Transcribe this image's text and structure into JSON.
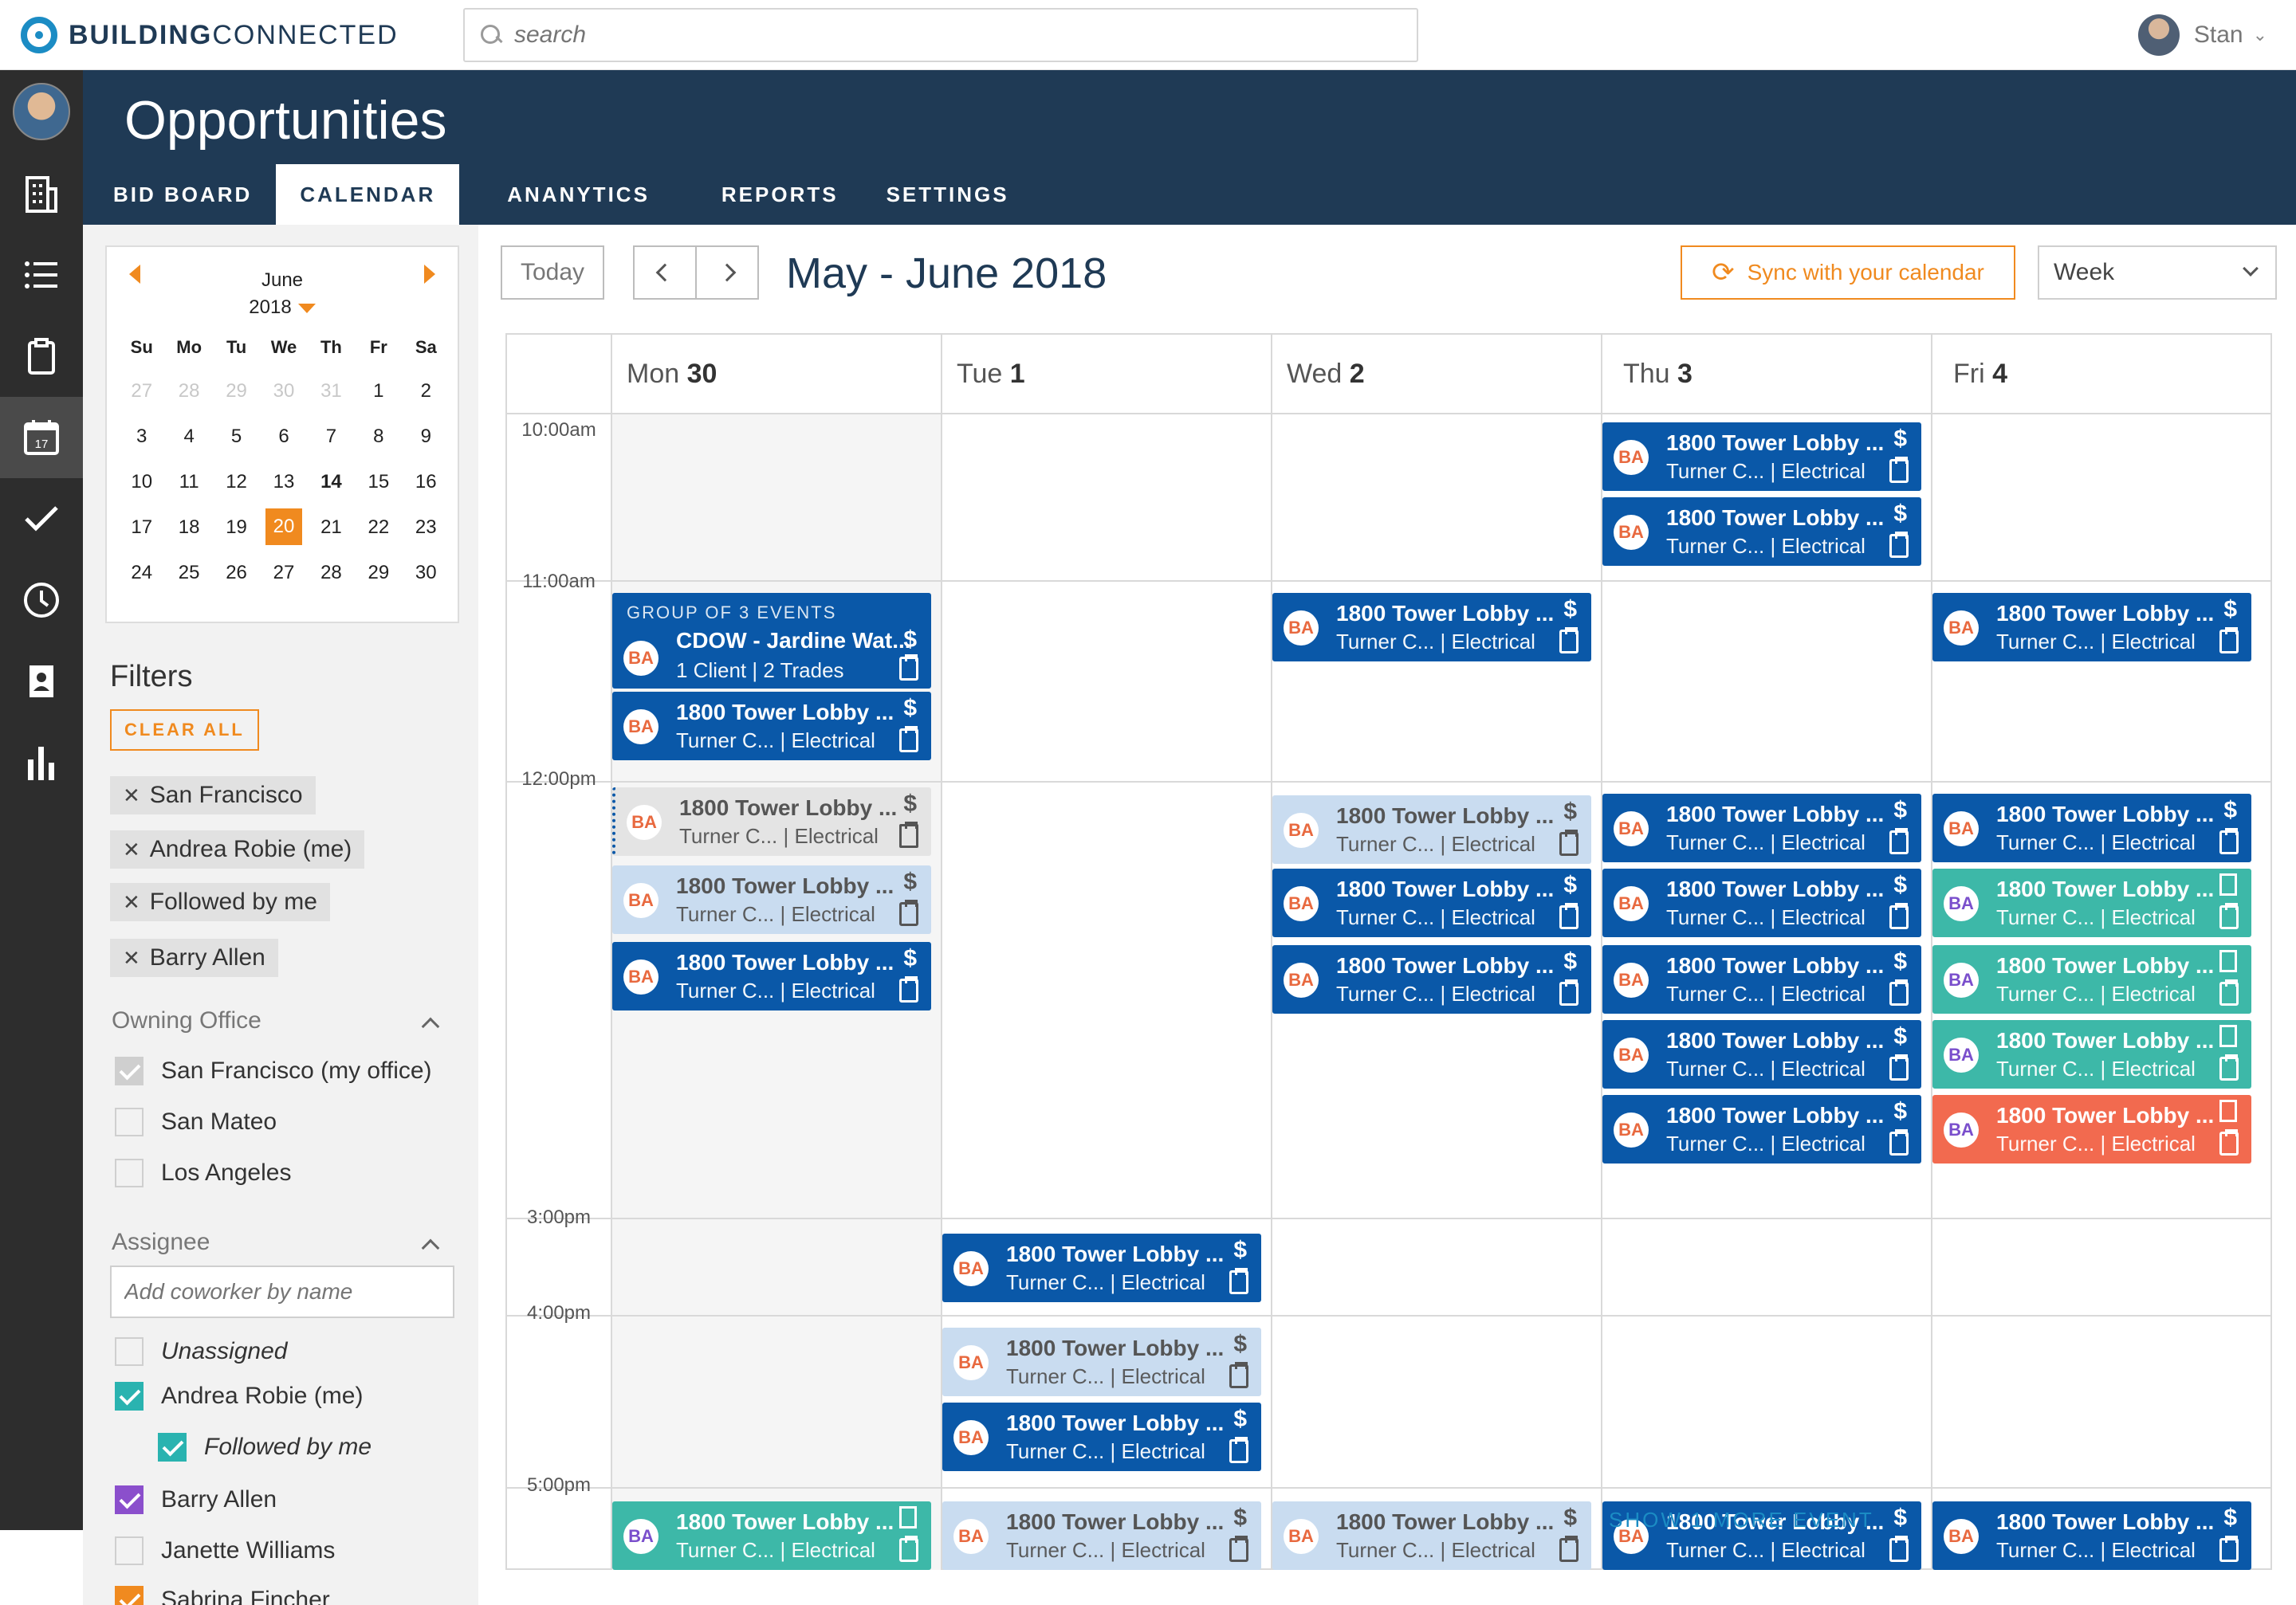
{
  "topbar": {
    "logo_bold": "BUILDING",
    "logo_light": "CONNECTED",
    "search_placeholder": "search",
    "user_name": "Stan"
  },
  "leftnav": {
    "items": [
      "avatar",
      "building-icon",
      "list-icon",
      "clipboard-icon",
      "calendar-icon",
      "check-icon",
      "clock-icon",
      "contacts-icon",
      "chart-icon"
    ],
    "active": "calendar-icon",
    "calendar_icon_number": "17"
  },
  "header": {
    "title": "Opportunities",
    "tabs": [
      {
        "label": "BID BOARD",
        "active": false
      },
      {
        "label": "CALENDAR",
        "active": true
      },
      {
        "label": "ANANYTICS",
        "active": false
      },
      {
        "label": "REPORTS",
        "active": false
      },
      {
        "label": "SETTINGS",
        "active": false
      }
    ]
  },
  "minical": {
    "month": "June",
    "year": "2018",
    "dows": [
      "Su",
      "Mo",
      "Tu",
      "We",
      "Th",
      "Fr",
      "Sa"
    ],
    "weeks": [
      [
        "27",
        "28",
        "29",
        "30",
        "31",
        "1",
        "2"
      ],
      [
        "3",
        "4",
        "5",
        "6",
        "7",
        "8",
        "9"
      ],
      [
        "10",
        "11",
        "12",
        "13",
        "14",
        "15",
        "16"
      ],
      [
        "17",
        "18",
        "19",
        "20",
        "21",
        "22",
        "23"
      ],
      [
        "24",
        "25",
        "26",
        "27",
        "28",
        "29",
        "30"
      ]
    ],
    "muted_first_row_count": 5,
    "bold_day": "14",
    "selected_day": "20"
  },
  "filters": {
    "title": "Filters",
    "clear_all": "CLEAR ALL",
    "chips": [
      "San Francisco",
      "Andrea Robie (me)",
      "Followed by me",
      "Barry Allen"
    ],
    "owning_office": {
      "title": "Owning Office",
      "options": [
        {
          "label": "San Francisco (my office)",
          "checked": true
        },
        {
          "label": "San Mateo",
          "checked": false
        },
        {
          "label": "Los Angeles",
          "checked": false
        }
      ]
    },
    "assignee": {
      "title": "Assignee",
      "placeholder": "Add coworker by name",
      "options": [
        {
          "label": "Unassigned",
          "checked": false
        },
        {
          "label": "Andrea Robie (me)",
          "checked": true,
          "color": "#2ab3b0"
        },
        {
          "label": "Followed by me",
          "checked": true,
          "color": "#2ab3b0"
        },
        {
          "label": "Barry Allen",
          "checked": true,
          "color": "#8b4fcc"
        },
        {
          "label": "Janette Williams",
          "checked": false
        },
        {
          "label": "Sabrina Fincher",
          "checked": true,
          "color": "#f08a1f"
        }
      ]
    }
  },
  "toolbar": {
    "today": "Today",
    "range_title": "May - June 2018",
    "sync": "Sync with your calendar",
    "view": "Week"
  },
  "calendar": {
    "days": [
      {
        "dow": "Mon",
        "num": "30"
      },
      {
        "dow": "Tue",
        "num": "1"
      },
      {
        "dow": "Wed",
        "num": "2"
      },
      {
        "dow": "Thu",
        "num": "3"
      },
      {
        "dow": "Fri",
        "num": "4"
      }
    ],
    "times": [
      "10:00am",
      "11:00am",
      "12:00pm",
      "3:00pm",
      "4:00pm",
      "5:00pm"
    ],
    "show_more": "SHOW 1 MORE EVENT",
    "event": {
      "title": "1800 Tower Lobby ...",
      "company": "Turner C...",
      "sep": "|",
      "trade": "Electrical",
      "badge": "BA"
    },
    "group_event": {
      "label": "GROUP OF 3 EVENTS",
      "title": "CDOW - Jardine Wat...",
      "sub": "1 Client | 2 Trades",
      "badge": "BA"
    },
    "colors": {
      "primary": "#0a58a8",
      "light": "#c9dcf0",
      "teal": "#3db8a8",
      "red": "#f26a4f",
      "accent": "#f08a1f",
      "header": "#1f3a55"
    }
  }
}
